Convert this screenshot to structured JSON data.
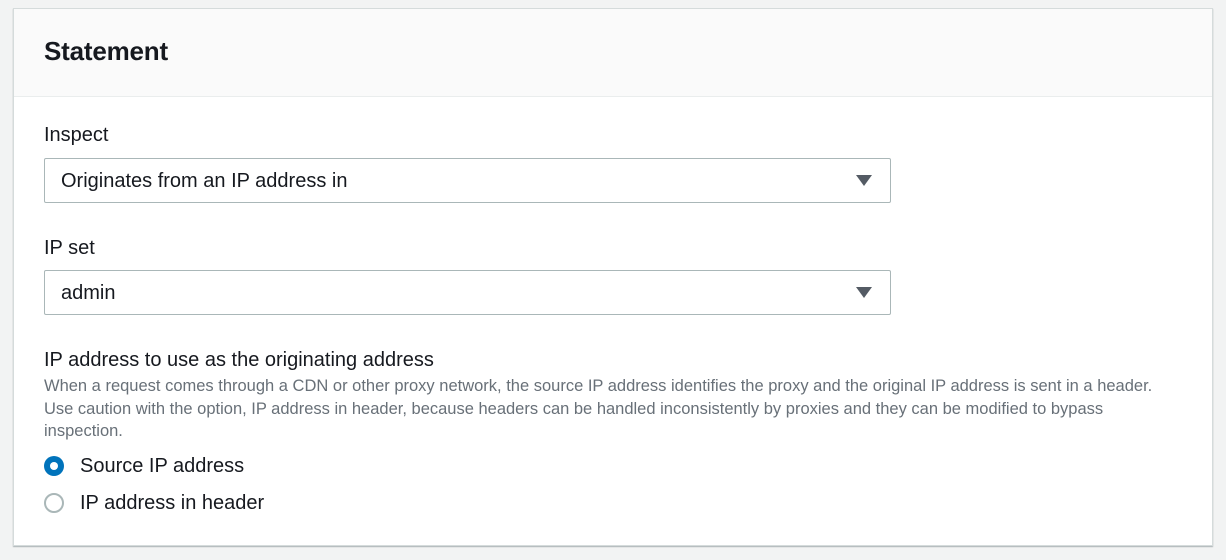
{
  "panel": {
    "title": "Statement"
  },
  "inspect": {
    "label": "Inspect",
    "selected": "Originates from an IP address in"
  },
  "ip_set": {
    "label": "IP set",
    "selected": "admin"
  },
  "originating_address": {
    "label": "IP address to use as the originating address",
    "description": "When a request comes through a CDN or other proxy network, the source IP address identifies the proxy and the original IP address is sent in a header. Use caution with the option, IP address in header, because headers can be handled inconsistently by proxies and they can be modified to bypass inspection.",
    "options": [
      {
        "label": "Source IP address",
        "checked": true
      },
      {
        "label": "IP address in header",
        "checked": false
      }
    ]
  },
  "colors": {
    "accent": "#0073bb",
    "text": "#16191f",
    "secondary_text": "#687078",
    "border": "#aab7b8"
  },
  "icons": {
    "select_caret": "caret-down-icon"
  }
}
